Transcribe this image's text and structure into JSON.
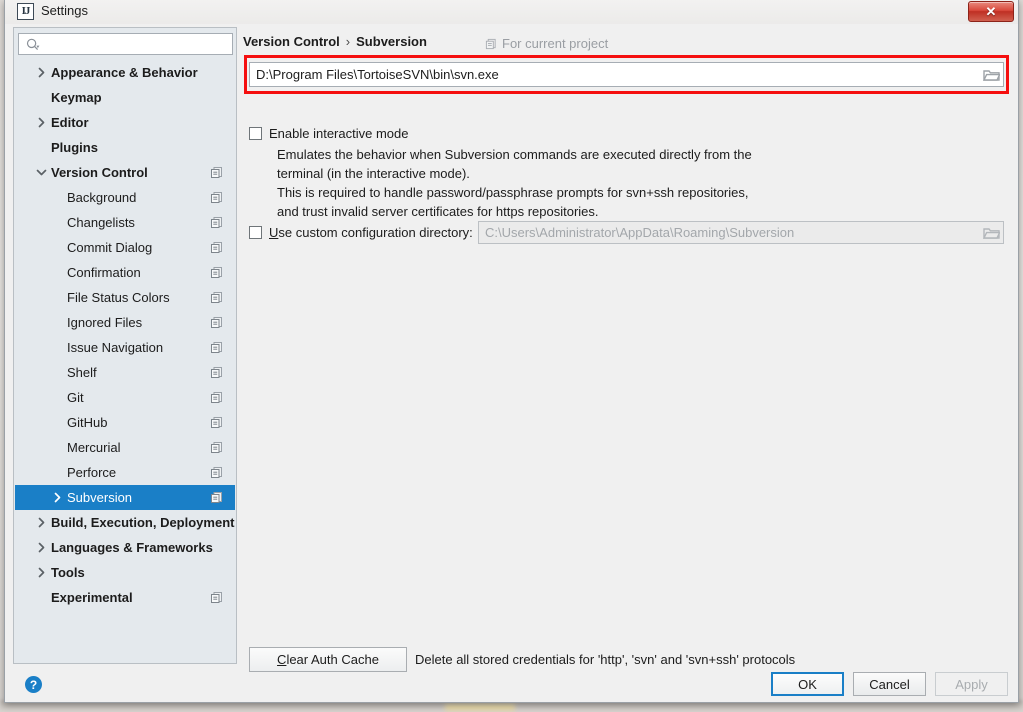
{
  "window": {
    "title": "Settings",
    "app_icon": "intellij-idea-icon",
    "close_label": "✕"
  },
  "sidebar": {
    "search": {
      "value": "",
      "placeholder": "",
      "icon": "search-icon"
    },
    "items": [
      {
        "label": "Appearance & Behavior",
        "level": "top",
        "arrow": "right",
        "copy": false,
        "selected": false
      },
      {
        "label": "Keymap",
        "level": "top",
        "arrow": "none",
        "copy": false,
        "selected": false
      },
      {
        "label": "Editor",
        "level": "top",
        "arrow": "right",
        "copy": false,
        "selected": false
      },
      {
        "label": "Plugins",
        "level": "top",
        "arrow": "none",
        "copy": false,
        "selected": false
      },
      {
        "label": "Version Control",
        "level": "top",
        "arrow": "down",
        "copy": true,
        "selected": false
      },
      {
        "label": "Background",
        "level": "child",
        "arrow": "none",
        "copy": true,
        "selected": false
      },
      {
        "label": "Changelists",
        "level": "child",
        "arrow": "none",
        "copy": true,
        "selected": false
      },
      {
        "label": "Commit Dialog",
        "level": "child",
        "arrow": "none",
        "copy": true,
        "selected": false
      },
      {
        "label": "Confirmation",
        "level": "child",
        "arrow": "none",
        "copy": true,
        "selected": false
      },
      {
        "label": "File Status Colors",
        "level": "child",
        "arrow": "none",
        "copy": true,
        "selected": false
      },
      {
        "label": "Ignored Files",
        "level": "child",
        "arrow": "none",
        "copy": true,
        "selected": false
      },
      {
        "label": "Issue Navigation",
        "level": "child",
        "arrow": "none",
        "copy": true,
        "selected": false
      },
      {
        "label": "Shelf",
        "level": "child",
        "arrow": "none",
        "copy": true,
        "selected": false
      },
      {
        "label": "Git",
        "level": "child",
        "arrow": "none",
        "copy": true,
        "selected": false
      },
      {
        "label": "GitHub",
        "level": "child",
        "arrow": "none",
        "copy": true,
        "selected": false
      },
      {
        "label": "Mercurial",
        "level": "child",
        "arrow": "none",
        "copy": true,
        "selected": false
      },
      {
        "label": "Perforce",
        "level": "child",
        "arrow": "none",
        "copy": true,
        "selected": false
      },
      {
        "label": "Subversion",
        "level": "child",
        "arrow": "right",
        "copy": true,
        "selected": true
      },
      {
        "label": "Build, Execution, Deployment",
        "level": "top",
        "arrow": "right",
        "copy": false,
        "selected": false
      },
      {
        "label": "Languages & Frameworks",
        "level": "top",
        "arrow": "right",
        "copy": false,
        "selected": false
      },
      {
        "label": "Tools",
        "level": "top",
        "arrow": "right",
        "copy": false,
        "selected": false
      },
      {
        "label": "Experimental",
        "level": "top",
        "arrow": "none",
        "copy": true,
        "selected": false
      }
    ]
  },
  "content": {
    "breadcrumb": {
      "parent": "Version Control",
      "separator": "›",
      "current": "Subversion"
    },
    "for_current_project": "For current project",
    "svn_path": {
      "value": "D:\\Program Files\\TortoiseSVN\\bin\\svn.exe",
      "browse_icon": "folder-icon"
    },
    "interactive_mode": {
      "label": "Enable interactive mode",
      "checked": false
    },
    "description": "Emulates the behavior when Subversion commands are executed directly from the\nterminal (in the interactive mode).\nThis is required to handle password/passphrase prompts for svn+ssh repositories,\nand trust invalid server certificates for https repositories.",
    "custom_dir": {
      "label_mnemonic": "U",
      "label_rest": "se custom configuration directory:",
      "checked": false,
      "value": "C:\\Users\\Administrator\\AppData\\Roaming\\Subversion",
      "browse_icon": "folder-icon"
    },
    "clear_auth": {
      "mnemonic": "C",
      "label_rest": "lear Auth Cache",
      "note": "Delete all stored credentials for 'http', 'svn' and 'svn+ssh' protocols"
    }
  },
  "footer": {
    "help": "?",
    "ok": "OK",
    "cancel": "Cancel",
    "apply": "Apply"
  },
  "annotation": {
    "highlight_color": "#f50f0f"
  },
  "colors": {
    "accent": "#1a7fc7",
    "sidebar_bg": "#e4e9ed",
    "panel_bg": "#f0f0f0"
  }
}
